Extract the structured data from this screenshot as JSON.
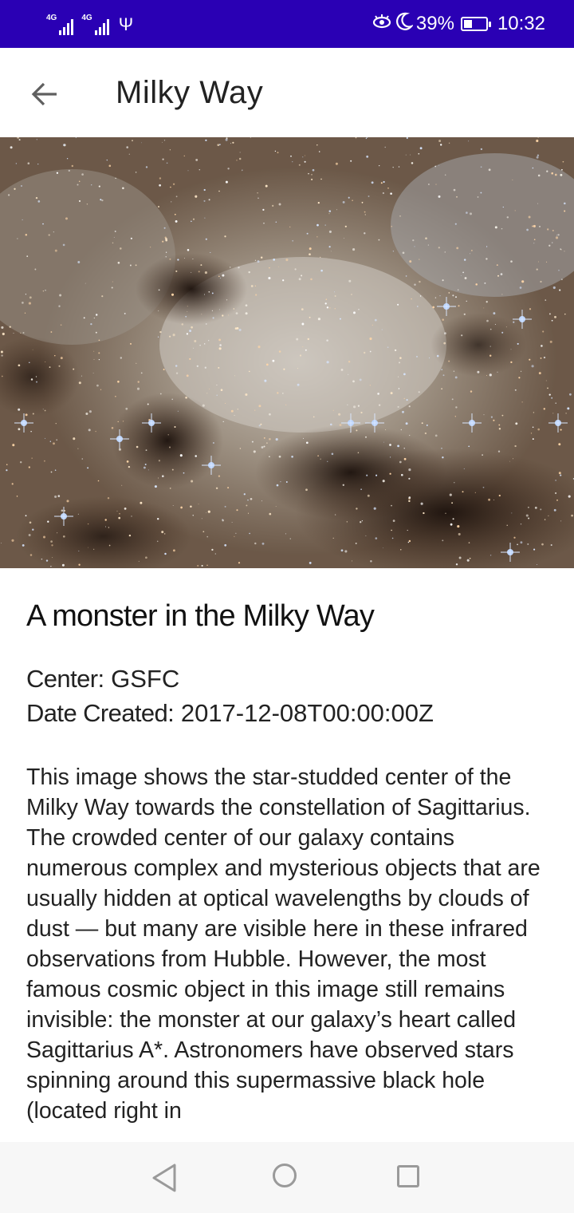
{
  "status_bar": {
    "network_1": "4G",
    "network_2": "4G",
    "battery_percent": "39%",
    "battery_level": 0.39,
    "time": "10:32",
    "icons": [
      "signal-icon",
      "signal-icon",
      "usb-icon",
      "eye-comfort-icon",
      "do-not-disturb-moon-icon",
      "battery-charging-icon"
    ],
    "background_color": "#2a00b4"
  },
  "app_bar": {
    "back_icon": "arrow-back-icon",
    "title": "Milky Way"
  },
  "article": {
    "image_description_icon": "galaxy-photo",
    "headline": "A monster in the Milky Way",
    "center_label": "Center:",
    "center_value": "GSFC",
    "date_label": "Date Created:",
    "date_value": "2017-12-08T00:00:00Z",
    "description": "This image shows the star-studded center of the Milky Way towards the constellation of Sagittarius. The crowded center of our galaxy contains numerous complex and mysterious objects that are usually hidden at optical wavelengths by clouds of dust — but many are visible here in these infrared observations from Hubble.  However, the most famous cosmic object in this image still remains invisible: the monster at our galaxy’s heart called Sagittarius A*. Astronomers have observed stars spinning around this supermassive black hole (located right in"
  },
  "nav_bar": {
    "back_icon": "nav-back-triangle-icon",
    "home_icon": "nav-home-circle-icon",
    "recents_icon": "nav-recents-square-icon"
  }
}
